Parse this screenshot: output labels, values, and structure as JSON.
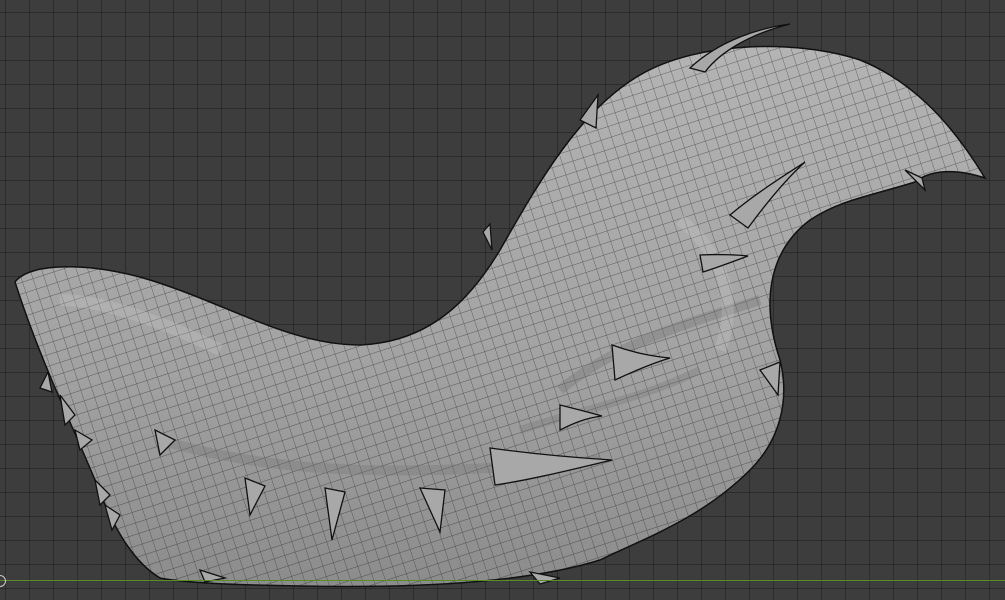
{
  "viewport": {
    "view": "3d-viewport",
    "mode": "wireframe-overlay",
    "mesh_object": "creature-head-sculpt"
  },
  "colors": {
    "background": "#3d3d3d",
    "grid": "#2a2a2a",
    "mesh_fill": "#9e9e9e",
    "mesh_wire": "#1c1c1c",
    "x_axis": "#5d8a2b"
  }
}
